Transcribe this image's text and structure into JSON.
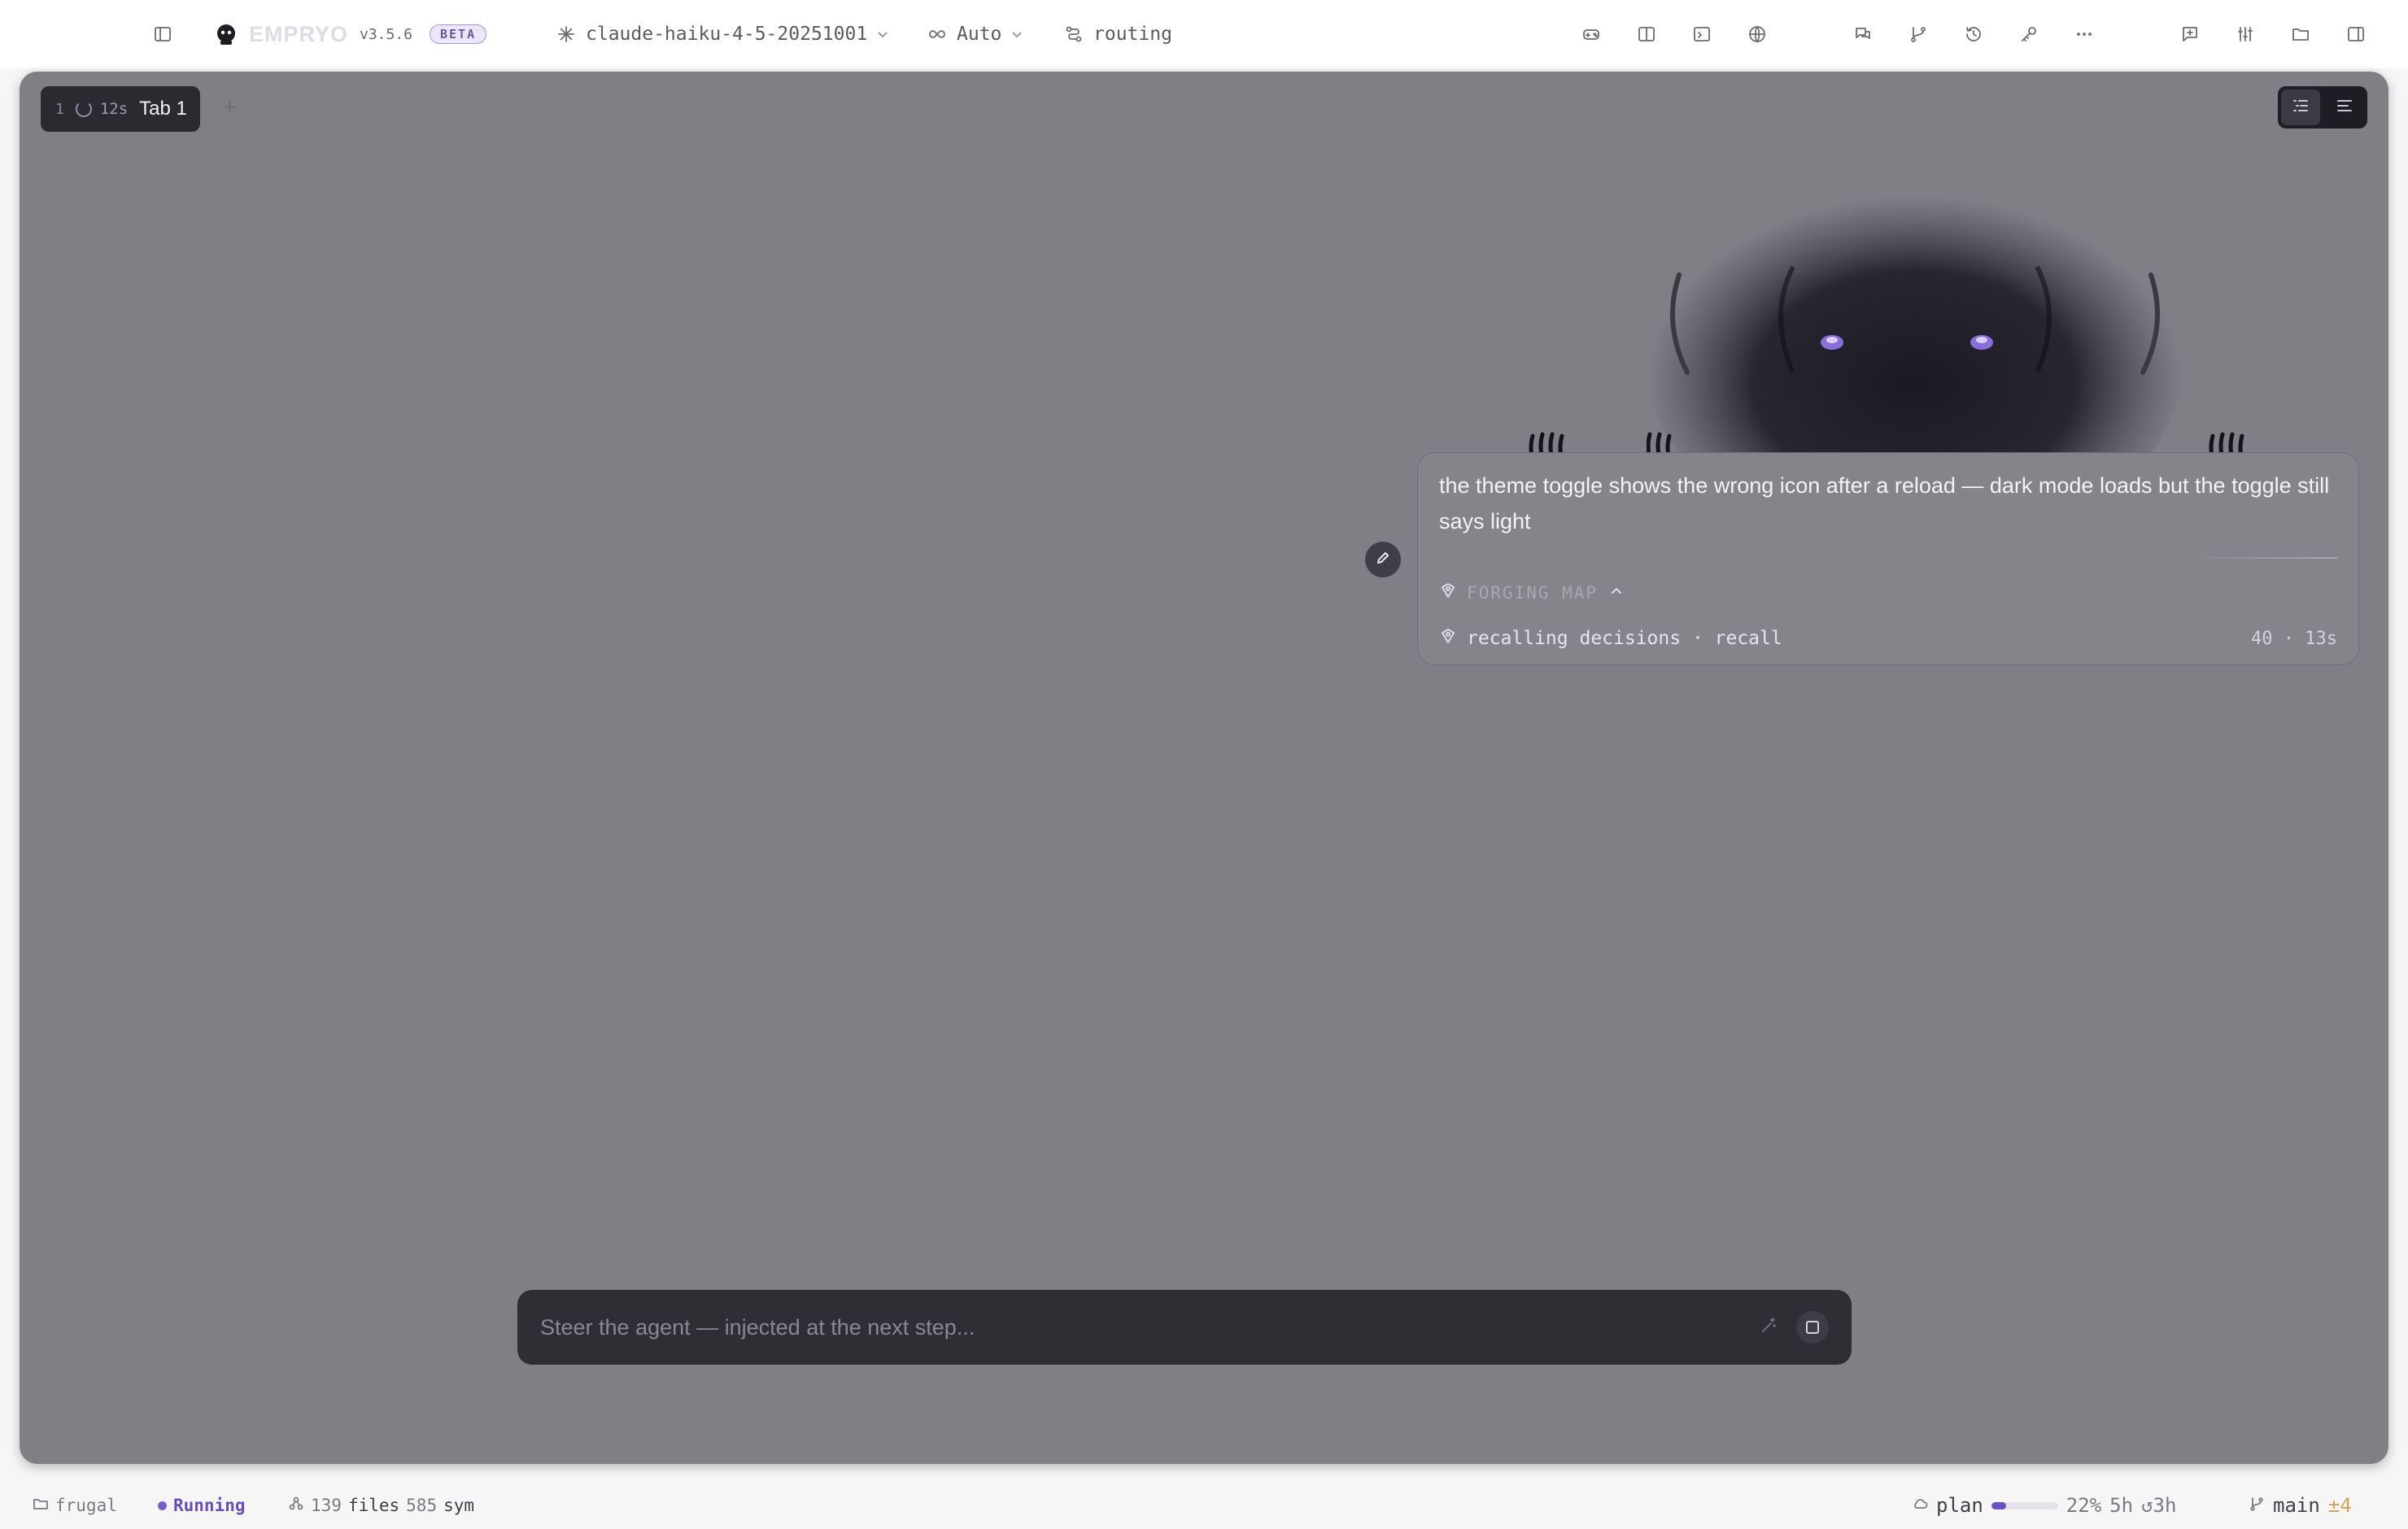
{
  "app": {
    "brand": "EMPRYO",
    "version": "v3.5.6",
    "badge": "BETA"
  },
  "toolbar": {
    "model": "claude-haiku-4-5-20251001",
    "mode": "Auto",
    "routing": "routing",
    "left_icons": [
      "sidebar-toggle-icon"
    ],
    "center_icons": [
      "gamepad-icon",
      "split-view-icon",
      "terminal-icon",
      "globe-icon"
    ],
    "right_icons_group1": [
      "chat-icon",
      "git-branch-icon",
      "history-icon",
      "key-icon",
      "more-icon"
    ],
    "right_icons_group2": [
      "new-message-icon",
      "sliders-icon",
      "folder-icon",
      "right-sidebar-icon"
    ]
  },
  "tabs": [
    {
      "number": "1",
      "elapsed": "12s",
      "label": "Tab 1"
    }
  ],
  "new_tab_label": "+",
  "message": {
    "text": "the theme toggle shows the wrong icon after a reload — dark mode loads but the toggle still says light",
    "forging_label": "FORGING MAP",
    "status_label": "recalling decisions · recall",
    "status_meta": "40 · 13s"
  },
  "steer": {
    "placeholder": "Steer the agent — injected at the next step..."
  },
  "statusbar": {
    "folder": "frugal",
    "state": "Running",
    "files_count": "139",
    "files_label": "files",
    "sym_count": "585",
    "sym_label": "sym",
    "plan_label": "plan",
    "plan_progress": 0.22,
    "plan_percent": "22%",
    "plan_time": "5h",
    "plan_reset": "↺3h",
    "branch": "main",
    "branch_changes": "±4"
  },
  "colors": {
    "accent": "#6a4fc0",
    "panel": "#807f86",
    "warning": "#d6a35a"
  }
}
